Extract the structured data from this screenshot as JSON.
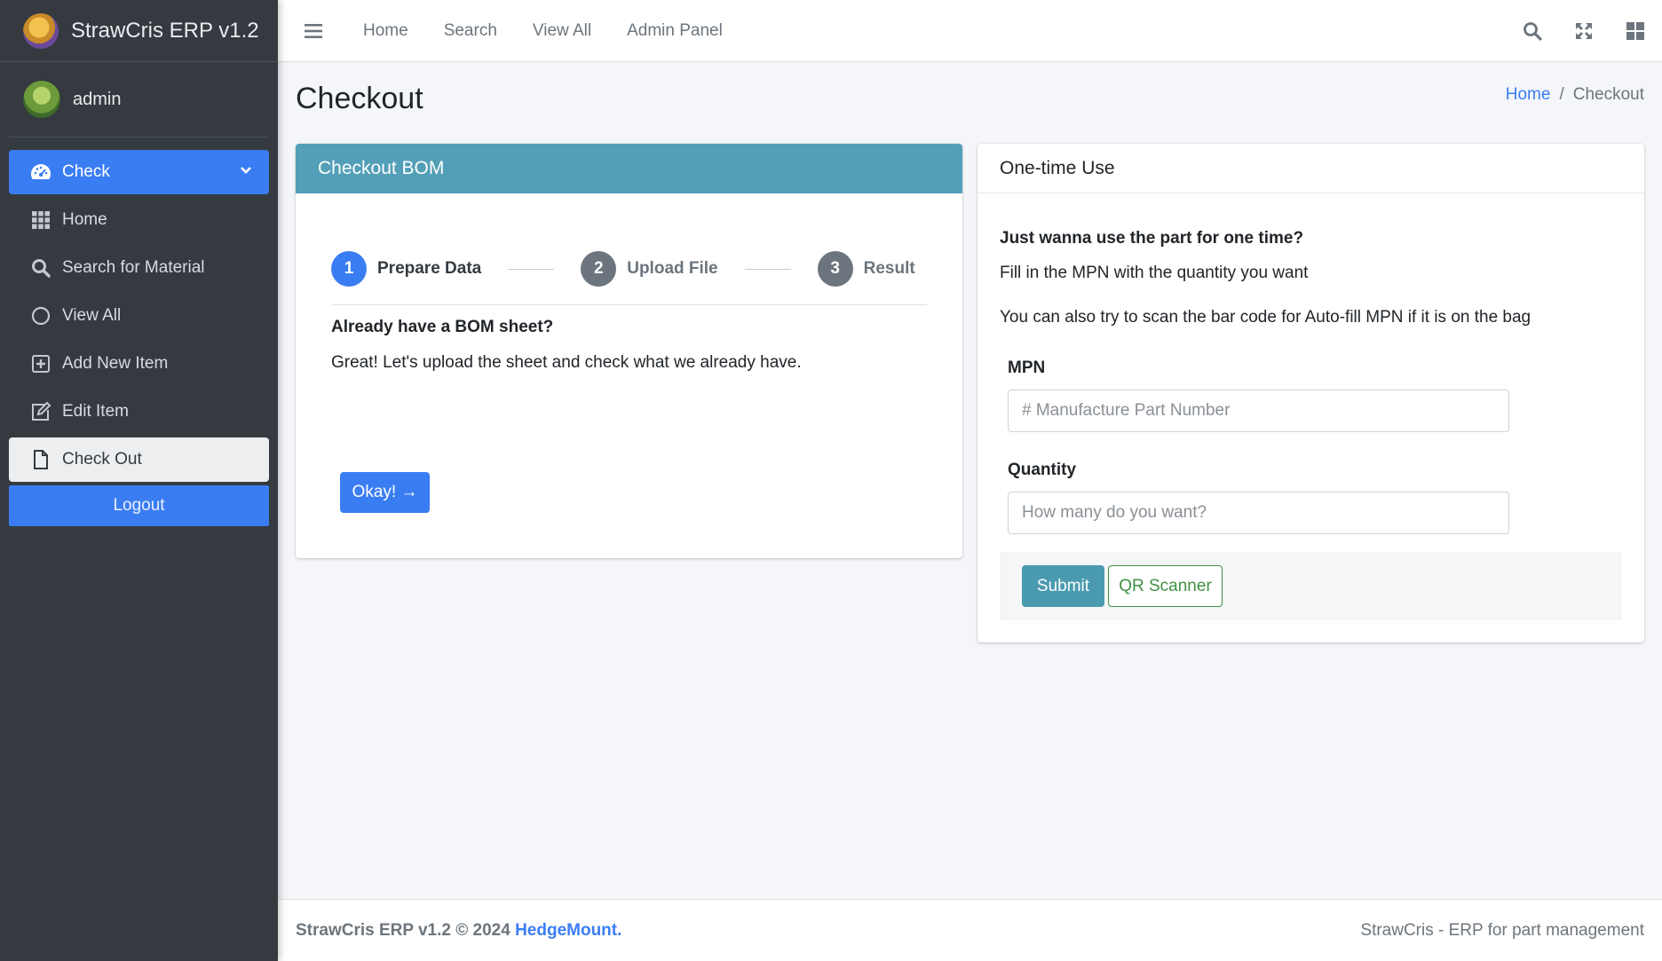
{
  "app": {
    "title": "StrawCris ERP v1.2"
  },
  "user": {
    "name": "admin"
  },
  "sidebar": {
    "items": [
      {
        "label": "Check",
        "icon": "dashboard-icon"
      },
      {
        "label": "Home",
        "icon": "grid-icon"
      },
      {
        "label": "Search for Material",
        "icon": "search-icon"
      },
      {
        "label": "View All",
        "icon": "circle-icon"
      },
      {
        "label": "Add New Item",
        "icon": "plus-square-icon"
      },
      {
        "label": "Edit Item",
        "icon": "edit-icon"
      },
      {
        "label": "Check Out",
        "icon": "file-icon"
      }
    ],
    "logout_label": "Logout"
  },
  "topnav": {
    "links": [
      "Home",
      "Search",
      "View All",
      "Admin Panel"
    ]
  },
  "page": {
    "title": "Checkout",
    "breadcrumb": {
      "home": "Home",
      "current": "Checkout"
    }
  },
  "bom_card": {
    "header": "Checkout BOM",
    "steps": [
      {
        "number": "1",
        "label": "Prepare Data"
      },
      {
        "number": "2",
        "label": "Upload File"
      },
      {
        "number": "3",
        "label": "Result"
      }
    ],
    "heading": "Already have a BOM sheet?",
    "text": "Great! Let's upload the sheet and check what we already have.",
    "button": "Okay! →"
  },
  "onetime_card": {
    "header": "One-time Use",
    "heading": "Just wanna use the part for one time?",
    "text1": "Fill in the MPN with the quantity you want",
    "text2": "You can also try to scan the bar code for Auto-fill MPN if it is on the bag",
    "mpn_label": "MPN",
    "mpn_placeholder": "# Manufacture Part Number",
    "qty_label": "Quantity",
    "qty_placeholder": "How many do you want?",
    "submit_label": "Submit",
    "qr_label": "QR Scanner"
  },
  "footer": {
    "left": "StrawCris ERP v1.2 © 2024 ",
    "link": "HedgeMount.",
    "right": "StrawCris - ERP for part management"
  },
  "colors": {
    "accent": "#3a7df3",
    "sidebar_bg": "#343a40",
    "card_header_teal": "#539fb8",
    "submit": "#4a9bb0",
    "qr_green": "#3f9142"
  }
}
